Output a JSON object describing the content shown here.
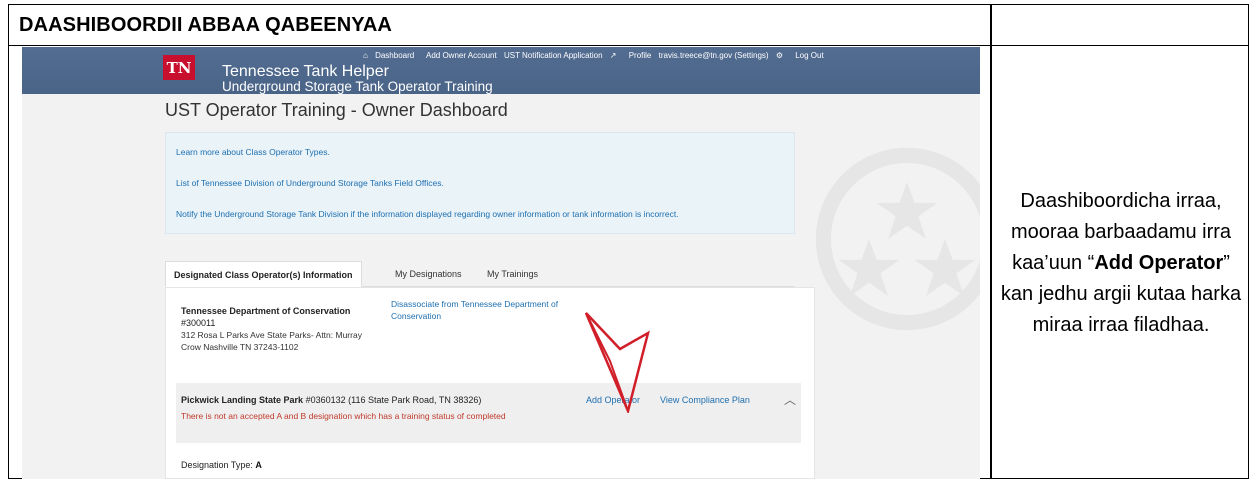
{
  "document": {
    "header_title": "DAASHIBOORDII ABBAA QABEENYAA",
    "instruction": {
      "before": "Daashiboordicha irraa, mooraa barbaadamu irra kaa’uun “",
      "bold": "Add Operator",
      "after": "” kan jedhu argii kutaa harka miraa irraa filadhaa."
    }
  },
  "app": {
    "logo_text": "TN",
    "title": "Tennessee Tank Helper",
    "subtitle": "Underground Storage Tank Operator Training",
    "nav": {
      "dashboard": "Dashboard",
      "add_owner": "Add Owner Account",
      "ust_notification": "UST Notification Application",
      "profile": "Profile",
      "user": "travis.treece@tn.gov (Settings)",
      "logout": "Log Out"
    }
  },
  "page": {
    "title": "UST Operator Training - Owner Dashboard",
    "info_links": [
      "Learn more about Class Operator Types.",
      "List of Tennessee Division of Underground Storage Tanks Field Offices.",
      "Notify the Underground Storage Tank Division if the information displayed regarding owner information or tank information is incorrect."
    ],
    "tabs": [
      "Designated Class Operator(s) Information",
      "My Designations",
      "My Trainings"
    ],
    "owner": {
      "name": "Tennessee Department of Conservation",
      "id": "#300011",
      "address": "312 Rosa L Parks Ave State Parks- Attn: Murray Crow Nashville TN 37243-1102",
      "disassociate": "Disassociate from Tennessee Department of Conservation"
    },
    "facility": {
      "name": "Pickwick Landing State Park",
      "detail": "#0360132 (116 State Park Road, TN 38326)",
      "warning": "There is not an accepted A and B designation which has a training status of completed",
      "add_operator": "Add Operator",
      "view_plan": "View Compliance Plan"
    },
    "designation_label": "Designation Type:",
    "designation_value": "A"
  },
  "colors": {
    "header_bar": "#4e6a8e",
    "link": "#1e6fb0",
    "warning": "#c0392b",
    "arrow": "#d11f2a",
    "tn_logo": "#c8102e"
  }
}
